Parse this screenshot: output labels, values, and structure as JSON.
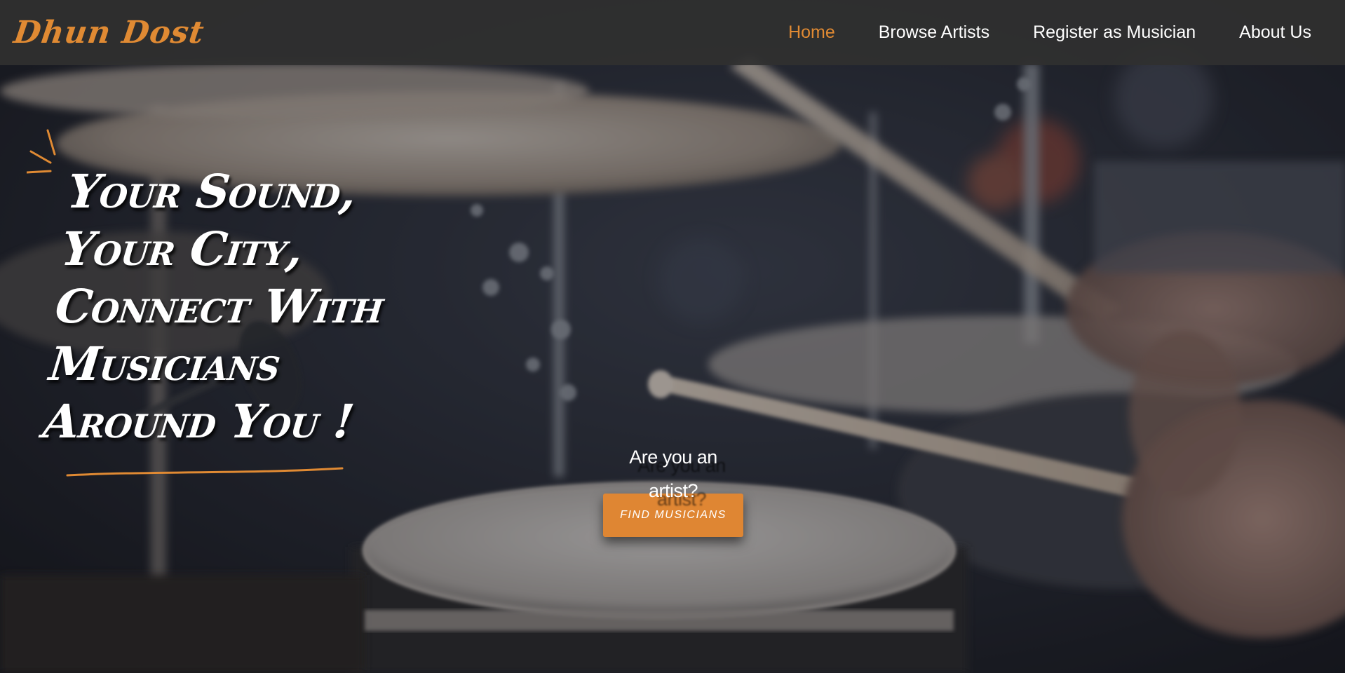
{
  "brand": {
    "name": "Dhun Dost",
    "color": "#e08a33"
  },
  "nav": {
    "items": [
      {
        "label": "Home",
        "active": true
      },
      {
        "label": "Browse Artists",
        "active": false
      },
      {
        "label": "Register as Musician",
        "active": false
      },
      {
        "label": "About Us",
        "active": false
      }
    ]
  },
  "hero": {
    "headline_lines": [
      "Your Sound,",
      "Your City,",
      "Connect With",
      "Musicians",
      "Around You !"
    ],
    "cta_question": "Are you an artist?",
    "cta_button": "Find Musicians",
    "background_subject": "drum-kit-photo"
  },
  "colors": {
    "accent": "#e08a33",
    "button": "#df8633",
    "navbar_bg": "#303030",
    "text": "#ffffff"
  }
}
